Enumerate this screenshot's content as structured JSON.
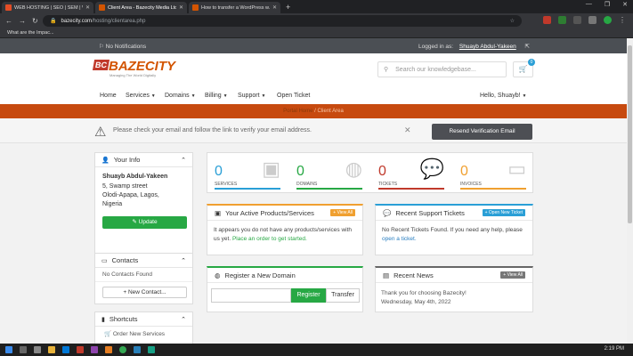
{
  "browser": {
    "tabs": [
      {
        "title": "WEB HOSTING | SEO | SEM | WI...",
        "color": "#e44d26"
      },
      {
        "title": "Client Area - Bazecity Media Ltd",
        "color": "#d35400"
      },
      {
        "title": "How to transfer a WordPress w...",
        "color": "#d35400"
      }
    ],
    "url_domain": "bazecity.com",
    "url_path": "/hosting/clientarea.php",
    "bookmark": "What are the Impac..."
  },
  "topbar": {
    "notifications": "No Notifications",
    "logged_in_label": "Logged in as:",
    "user": "Shuayb Abdul-Yakeen"
  },
  "header": {
    "logo_badge": "BC",
    "logo_text": "BAZECITY",
    "logo_tag": "Managing The World Digitally",
    "search_placeholder": "Search our knowledgebase...",
    "cart_count": "0"
  },
  "nav": {
    "home": "Home",
    "services": "Services",
    "domains": "Domains",
    "billing": "Billing",
    "support": "Support",
    "open_ticket": "Open Ticket",
    "greeting": "Hello, Shuayb!"
  },
  "breadcrumb": {
    "home": "Portal Home",
    "sep": "/",
    "current": "Client Area"
  },
  "verify": {
    "message": "Please check your email and follow the link to verify your email address.",
    "button": "Resend Verification Email"
  },
  "your_info": {
    "title": "Your Info",
    "name": "Shuayb Abdul-Yakeen",
    "address1": "5, Swamp street",
    "address2": "Olodi-Apapa, Lagos,",
    "country": "Nigeria",
    "update": "Update"
  },
  "contacts": {
    "title": "Contacts",
    "empty": "No Contacts Found",
    "new_button": "+ New Contact..."
  },
  "shortcuts": {
    "title": "Shortcuts",
    "first": "Order New Services"
  },
  "stats": [
    {
      "value": "0",
      "label": "SERVICES",
      "color": "#2a9fd6"
    },
    {
      "value": "0",
      "label": "DOMAINS",
      "color": "#27a844"
    },
    {
      "value": "0",
      "label": "TICKETS",
      "color": "#c0392b"
    },
    {
      "value": "0",
      "label": "INVOICES",
      "color": "#f0a030"
    }
  ],
  "products": {
    "title": "Your Active Products/Services",
    "btn": "+ View All",
    "text1": "It appears you do not have any products/services with",
    "text2": "us yet.",
    "link": "Place an order to get started."
  },
  "tickets": {
    "title": "Recent Support Tickets",
    "btn": "+ Open New Ticket",
    "text1": "No Recent Tickets Found. If you need any help, please",
    "link": "open a ticket."
  },
  "domain": {
    "title": "Register a New Domain",
    "register": "Register",
    "transfer": "Transfer"
  },
  "news": {
    "title": "Recent News",
    "btn": "View All",
    "item": "Thank you for choosing Bazecity!",
    "date": "Wednesday, May 4th, 2022"
  },
  "taskbar": {
    "time": "2:19 PM"
  }
}
